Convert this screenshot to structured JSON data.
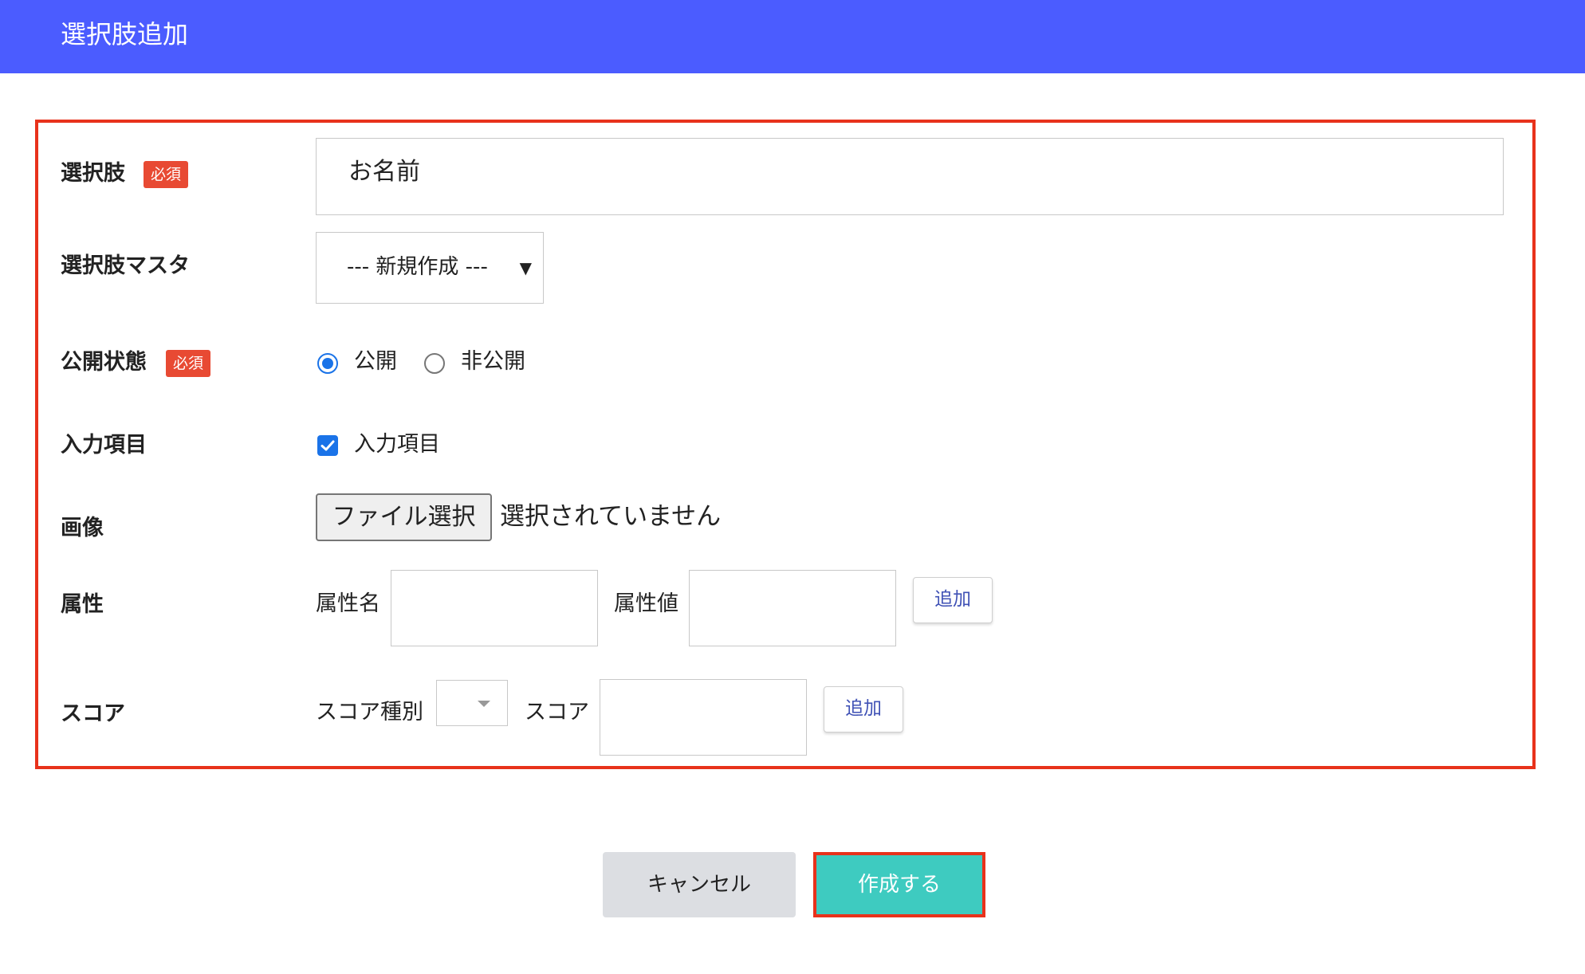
{
  "header": {
    "title": "選択肢追加"
  },
  "form": {
    "choice": {
      "label": "選択肢",
      "required_badge": "必須",
      "value": "お名前"
    },
    "choice_master": {
      "label": "選択肢マスタ",
      "selected": "--- 新規作成 ---"
    },
    "visibility": {
      "label": "公開状態",
      "required_badge": "必須",
      "options": [
        {
          "label": "公開",
          "checked": true
        },
        {
          "label": "非公開",
          "checked": false
        }
      ]
    },
    "input_item": {
      "label": "入力項目",
      "checkbox_label": "入力項目",
      "checked": true
    },
    "image": {
      "label": "画像",
      "button_label": "ファイル選択",
      "status": "選択されていません"
    },
    "attribute": {
      "label": "属性",
      "name_label": "属性名",
      "value_label": "属性値",
      "add_label": "追加"
    },
    "score": {
      "label": "スコア",
      "type_label": "スコア種別",
      "score_label": "スコア",
      "add_label": "追加"
    }
  },
  "actions": {
    "cancel_label": "キャンセル",
    "create_label": "作成する"
  },
  "colors": {
    "header": "#4b5cff",
    "highlight": "#e8321b",
    "badge": "#e84a33",
    "create": "#3ecbc0",
    "cancel": "#dcdee2",
    "accent": "#1a73e8"
  }
}
